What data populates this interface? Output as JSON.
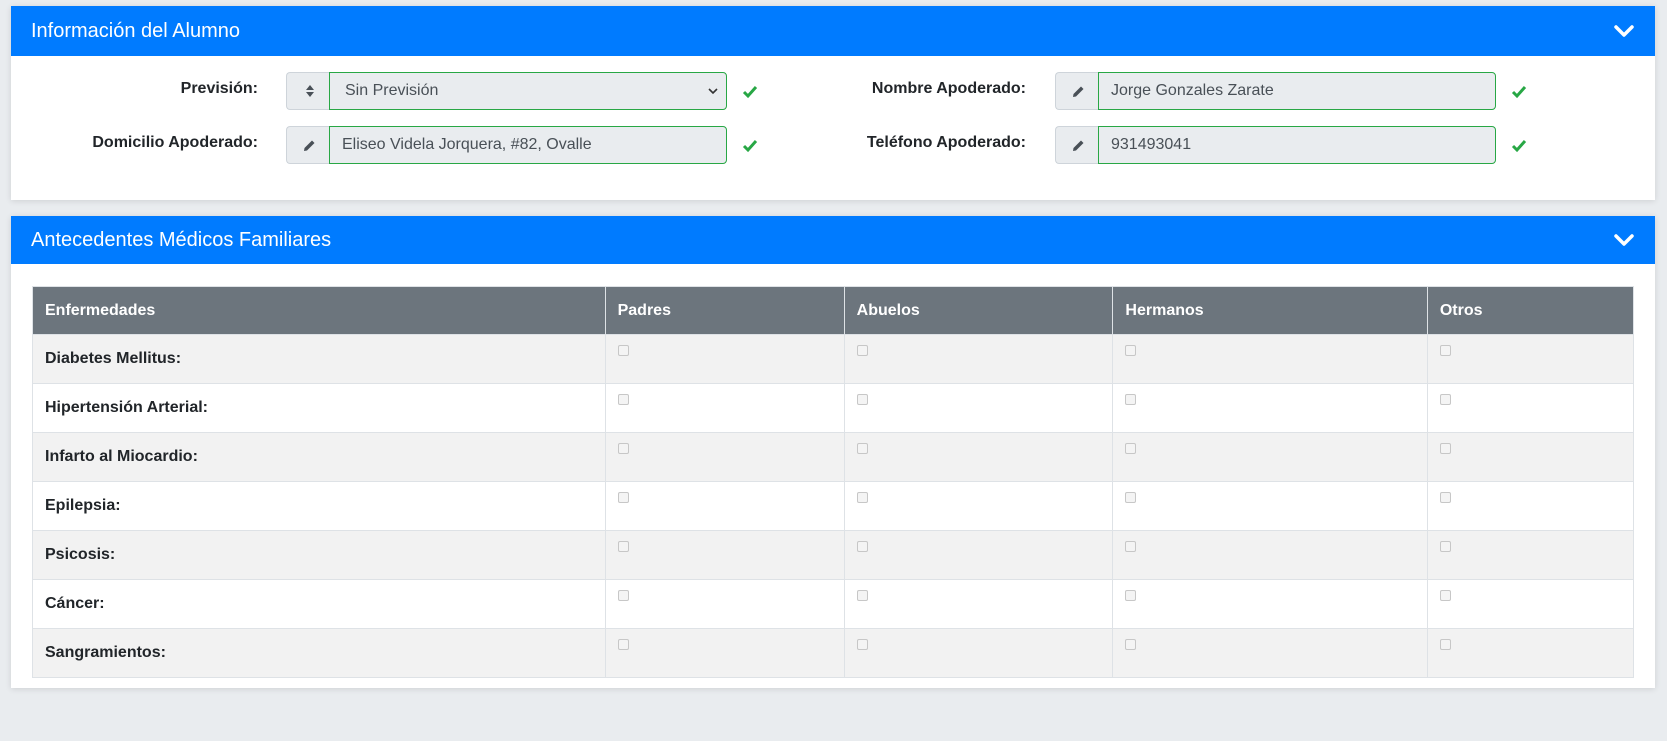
{
  "student_card": {
    "title": "Información del Alumno",
    "fields": {
      "prevision": {
        "label": "Previsión:",
        "value": "Sin Previsión"
      },
      "nombre_apoderado": {
        "label": "Nombre Apoderado:",
        "value": "Jorge Gonzales Zarate"
      },
      "domicilio_apoderado": {
        "label": "Domicilio Apoderado:",
        "value": "Eliseo Videla Jorquera, #82, Ovalle"
      },
      "telefono_apoderado": {
        "label": "Teléfono Apoderado:",
        "value": "931493041"
      }
    },
    "valid_color": "#28a745"
  },
  "medical_card": {
    "title": "Antecedentes Médicos Familiares",
    "columns": [
      "Enfermedades",
      "Padres",
      "Abuelos",
      "Hermanos",
      "Otros"
    ],
    "rows": [
      {
        "label": "Diabetes Mellitus:",
        "checks": [
          false,
          false,
          false,
          false
        ]
      },
      {
        "label": "Hipertensión Arterial:",
        "checks": [
          false,
          false,
          false,
          false
        ]
      },
      {
        "label": "Infarto al Miocardio:",
        "checks": [
          false,
          false,
          false,
          false
        ]
      },
      {
        "label": "Epilepsia:",
        "checks": [
          false,
          false,
          false,
          false
        ]
      },
      {
        "label": "Psicosis:",
        "checks": [
          false,
          false,
          false,
          false
        ]
      },
      {
        "label": "Cáncer:",
        "checks": [
          false,
          false,
          false,
          false
        ]
      },
      {
        "label": "Sangramientos:",
        "checks": [
          false,
          false,
          false,
          false
        ]
      }
    ]
  },
  "colors": {
    "header": "#007bff",
    "table_header": "#6c757d"
  },
  "icons": {
    "collapse": "chevron-down-icon",
    "edit": "pencil-icon",
    "sort": "sort-icon",
    "valid": "check-icon"
  }
}
